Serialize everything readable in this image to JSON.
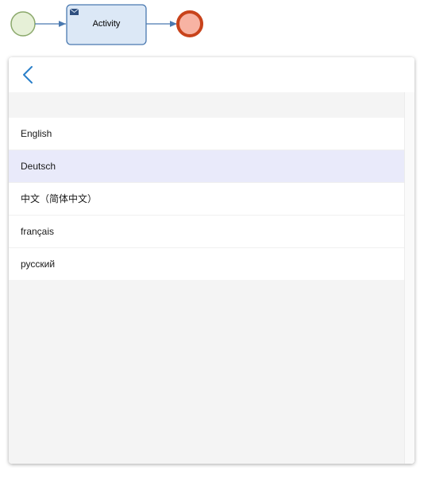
{
  "diagram": {
    "activity_label": "Activity",
    "icons": {
      "start_event": "start-event-circle",
      "task_icon": "envelope-icon",
      "end_event": "end-event-circle"
    },
    "colors": {
      "start_fill": "#e6f0d7",
      "start_stroke": "#8aa86a",
      "task_fill": "#dce8f6",
      "task_stroke": "#4a79b0",
      "end_fill": "#f7b3a3",
      "end_stroke": "#c8431b",
      "flow": "#4a79b0"
    }
  },
  "panel": {
    "back_icon": "chevron-left-icon",
    "languages": [
      {
        "label": "English",
        "selected": false
      },
      {
        "label": "Deutsch",
        "selected": true
      },
      {
        "label": "中文（简体中文）",
        "selected": false
      },
      {
        "label": "français",
        "selected": false
      },
      {
        "label": "русский",
        "selected": false
      }
    ],
    "colors": {
      "accent": "#2a7fc9",
      "selected_row": "#e9eafa"
    }
  }
}
